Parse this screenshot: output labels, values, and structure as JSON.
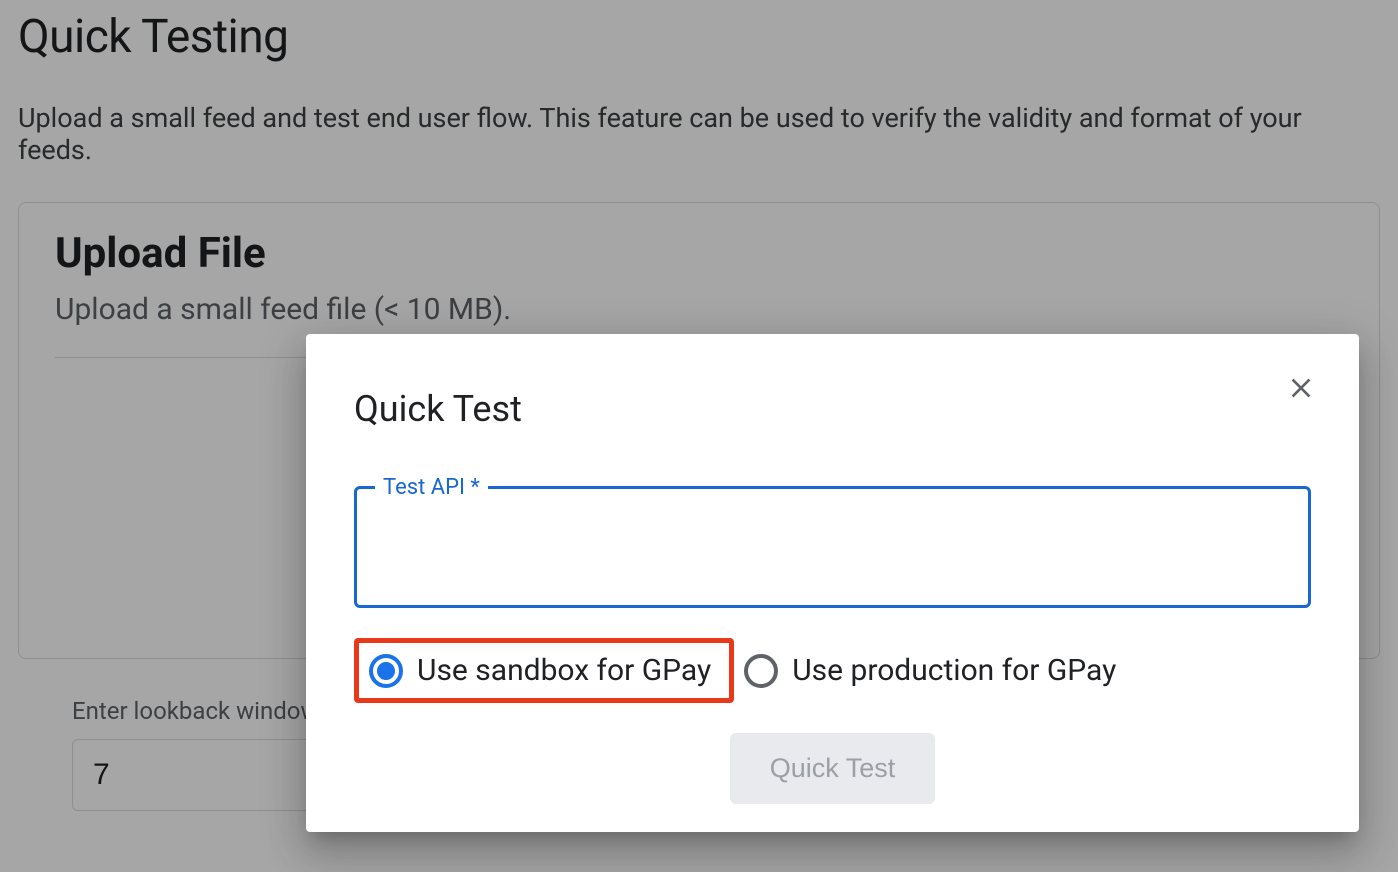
{
  "page": {
    "title": "Quick Testing",
    "description": "Upload a small feed and test end user flow. This feature can be used to verify the validity and format of your feeds."
  },
  "upload_card": {
    "title": "Upload File",
    "description": "Upload a small feed file (< 10 MB)."
  },
  "lookback": {
    "label": "Enter lookback window",
    "value": "7"
  },
  "modal": {
    "title": "Quick Test",
    "field_label": "Test API *",
    "radio_sandbox": "Use sandbox for GPay",
    "radio_production": "Use production for GPay",
    "button_label": "Quick Test"
  }
}
